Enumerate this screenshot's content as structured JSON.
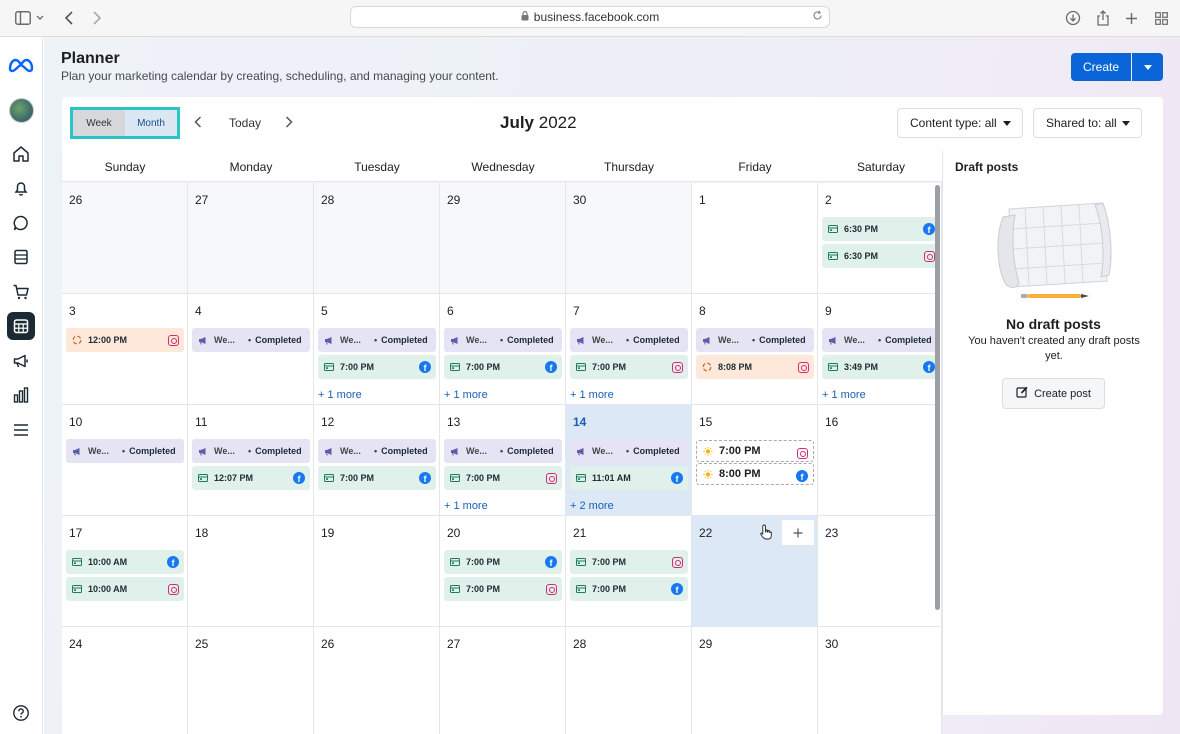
{
  "browser": {
    "url": "business.facebook.com"
  },
  "header": {
    "title": "Planner",
    "subtitle": "Plan your marketing calendar by creating, scheduling, and managing your content.",
    "create_label": "Create"
  },
  "toolbar": {
    "week_label": "Week",
    "month_label": "Month",
    "active_view": "Month",
    "today_label": "Today",
    "month_name": "July",
    "year": "2022",
    "content_type_label": "Content type: all",
    "shared_to_label": "Shared to: all"
  },
  "days_of_week": [
    "Sunday",
    "Monday",
    "Tuesday",
    "Wednesday",
    "Thursday",
    "Friday",
    "Saturday"
  ],
  "calendar": {
    "weeks": [
      [
        {
          "day": "26",
          "out": true,
          "events": []
        },
        {
          "day": "27",
          "out": true,
          "events": []
        },
        {
          "day": "28",
          "out": true,
          "events": []
        },
        {
          "day": "29",
          "out": true,
          "events": []
        },
        {
          "day": "30",
          "out": true,
          "events": []
        },
        {
          "day": "1",
          "events": []
        },
        {
          "day": "2",
          "events": [
            {
              "kind": "post",
              "time": "6:30 PM",
              "platform": "facebook",
              "color": "green"
            },
            {
              "kind": "post",
              "time": "6:30 PM",
              "platform": "instagram",
              "color": "green"
            }
          ]
        }
      ],
      [
        {
          "day": "3",
          "events": [
            {
              "kind": "draft",
              "time": "12:00 PM",
              "platform": "instagram",
              "color": "orange"
            }
          ]
        },
        {
          "day": "4",
          "events": [
            {
              "kind": "campaign",
              "label": "We...",
              "status": "Completed",
              "color": "lilac"
            }
          ]
        },
        {
          "day": "5",
          "more": "+ 1 more",
          "events": [
            {
              "kind": "campaign",
              "label": "We...",
              "status": "Completed",
              "color": "lilac"
            },
            {
              "kind": "post",
              "time": "7:00 PM",
              "platform": "facebook",
              "color": "green"
            }
          ]
        },
        {
          "day": "6",
          "more": "+ 1 more",
          "events": [
            {
              "kind": "campaign",
              "label": "We...",
              "status": "Completed",
              "color": "lilac"
            },
            {
              "kind": "post",
              "time": "7:00 PM",
              "platform": "facebook",
              "color": "green"
            }
          ]
        },
        {
          "day": "7",
          "more": "+ 1 more",
          "events": [
            {
              "kind": "campaign",
              "label": "We...",
              "status": "Completed",
              "color": "lilac"
            },
            {
              "kind": "post",
              "time": "7:00 PM",
              "platform": "instagram",
              "color": "green"
            }
          ]
        },
        {
          "day": "8",
          "events": [
            {
              "kind": "campaign",
              "label": "We...",
              "status": "Completed",
              "color": "lilac"
            },
            {
              "kind": "draft",
              "time": "8:08 PM",
              "platform": "instagram",
              "color": "orange"
            }
          ]
        },
        {
          "day": "9",
          "more": "+ 1 more",
          "events": [
            {
              "kind": "campaign",
              "label": "We...",
              "status": "Completed",
              "color": "lilac"
            },
            {
              "kind": "post",
              "time": "3:49 PM",
              "platform": "facebook",
              "color": "green"
            }
          ]
        }
      ],
      [
        {
          "day": "10",
          "events": [
            {
              "kind": "campaign",
              "label": "We...",
              "status": "Completed",
              "color": "lilac"
            }
          ]
        },
        {
          "day": "11",
          "events": [
            {
              "kind": "campaign",
              "label": "We...",
              "status": "Completed",
              "color": "lilac"
            },
            {
              "kind": "post",
              "time": "12:07 PM",
              "platform": "facebook",
              "color": "green"
            }
          ]
        },
        {
          "day": "12",
          "events": [
            {
              "kind": "campaign",
              "label": "We...",
              "status": "Completed",
              "color": "lilac"
            },
            {
              "kind": "post",
              "time": "7:00 PM",
              "platform": "facebook",
              "color": "green"
            }
          ]
        },
        {
          "day": "13",
          "more": "+ 1 more",
          "events": [
            {
              "kind": "campaign",
              "label": "We...",
              "status": "Completed",
              "color": "lilac"
            },
            {
              "kind": "post",
              "time": "7:00 PM",
              "platform": "instagram",
              "color": "green"
            }
          ]
        },
        {
          "day": "14",
          "today": true,
          "more": "+ 2 more",
          "events": [
            {
              "kind": "campaign",
              "label": "We...",
              "status": "Completed",
              "color": "lilac"
            },
            {
              "kind": "post",
              "time": "11:01 AM",
              "platform": "facebook",
              "color": "green"
            }
          ]
        },
        {
          "day": "15",
          "events": [
            {
              "kind": "suggested",
              "time": "7:00 PM",
              "platform": "instagram",
              "color": "dashed"
            },
            {
              "kind": "suggested",
              "time": "8:00 PM",
              "platform": "facebook",
              "color": "dashed"
            }
          ]
        },
        {
          "day": "16",
          "events": []
        }
      ],
      [
        {
          "day": "17",
          "events": [
            {
              "kind": "post",
              "time": "10:00 AM",
              "platform": "facebook",
              "color": "green"
            },
            {
              "kind": "post",
              "time": "10:00 AM",
              "platform": "instagram",
              "color": "green"
            }
          ]
        },
        {
          "day": "18",
          "events": []
        },
        {
          "day": "19",
          "events": []
        },
        {
          "day": "20",
          "events": [
            {
              "kind": "post",
              "time": "7:00 PM",
              "platform": "facebook",
              "color": "green"
            },
            {
              "kind": "post",
              "time": "7:00 PM",
              "platform": "instagram",
              "color": "green"
            }
          ]
        },
        {
          "day": "21",
          "events": [
            {
              "kind": "post",
              "time": "7:00 PM",
              "platform": "instagram",
              "color": "green"
            },
            {
              "kind": "post",
              "time": "7:00 PM",
              "platform": "facebook",
              "color": "green"
            }
          ]
        },
        {
          "day": "22",
          "hover": true,
          "events": []
        },
        {
          "day": "23",
          "events": []
        }
      ],
      [
        {
          "day": "24",
          "events": []
        },
        {
          "day": "25",
          "events": []
        },
        {
          "day": "26",
          "events": []
        },
        {
          "day": "27",
          "events": []
        },
        {
          "day": "28",
          "events": []
        },
        {
          "day": "29",
          "events": []
        },
        {
          "day": "30",
          "events": []
        }
      ]
    ]
  },
  "drafts": {
    "title": "Draft posts",
    "empty_title": "No draft posts",
    "empty_text": "You haven't created any draft posts yet.",
    "create_label": "Create post"
  },
  "colors": {
    "accent": "#0a66d8",
    "facebook": "#1877f2",
    "instagram": "#d62976",
    "today_bg": "#dde8f7",
    "toggle_border": "#2bc4c4"
  }
}
